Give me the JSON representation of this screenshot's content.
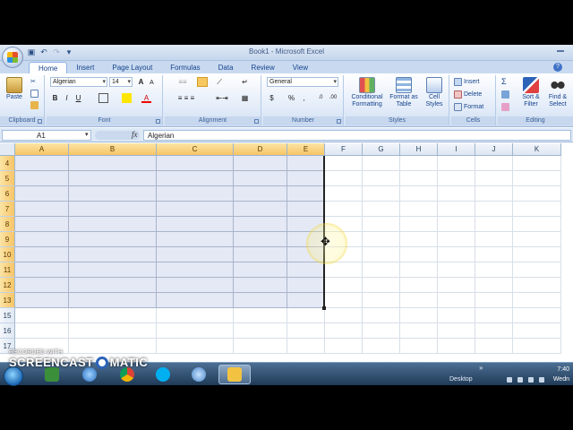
{
  "window": {
    "title": "Book1 - Microsoft Excel"
  },
  "qat": {
    "save_icon": "save-icon",
    "undo_icon": "undo-icon",
    "redo_icon": "redo-icon",
    "customize_icon": "qat-customize-icon"
  },
  "tabs": [
    {
      "label": "Home",
      "active": true
    },
    {
      "label": "Insert"
    },
    {
      "label": "Page Layout"
    },
    {
      "label": "Formulas"
    },
    {
      "label": "Data"
    },
    {
      "label": "Review"
    },
    {
      "label": "View"
    }
  ],
  "ribbon": {
    "clipboard": {
      "label": "Clipboard",
      "paste": "Paste"
    },
    "font": {
      "label": "Font",
      "font_name": "Algerian",
      "font_size": "14",
      "bold": "B",
      "italic": "I",
      "underline": "U"
    },
    "alignment": {
      "label": "Alignment"
    },
    "number": {
      "label": "Number",
      "format": "General",
      "currency": "$",
      "percent": "%",
      "comma": ","
    },
    "styles": {
      "label": "Styles",
      "conditional_formatting": "Conditional Formatting",
      "format_as_table": "Format as Table",
      "cell_styles": "Cell Styles"
    },
    "cells": {
      "label": "Cells",
      "insert": "Insert",
      "delete": "Delete",
      "format": "Format"
    },
    "editing": {
      "label": "Editing",
      "sigma": "Σ",
      "sort_filter": "Sort & Filter",
      "find_select": "Find & Select"
    }
  },
  "formula_bar": {
    "name_box": "A1",
    "fx": "fx",
    "value": "Algerian"
  },
  "grid": {
    "columns": [
      "A",
      "B",
      "C",
      "D",
      "E",
      "F",
      "G",
      "H",
      "I",
      "J",
      "K"
    ],
    "selected_columns": [
      "A",
      "B",
      "C",
      "D",
      "E"
    ],
    "rows": [
      "4",
      "5",
      "6",
      "7",
      "8",
      "9",
      "10",
      "11",
      "12",
      "13",
      "15",
      "16",
      "17"
    ],
    "selected_rows": [
      "4",
      "5",
      "6",
      "7",
      "8",
      "9",
      "10",
      "11",
      "12",
      "13"
    ]
  },
  "taskbar": {
    "desktop_label": "Desktop",
    "chevron": "»",
    "clock": "7:40",
    "day": "Wedn"
  },
  "watermark": {
    "small": "RECORDED WITH",
    "big_a": "SCREENCAST",
    "big_b": "MATIC"
  }
}
